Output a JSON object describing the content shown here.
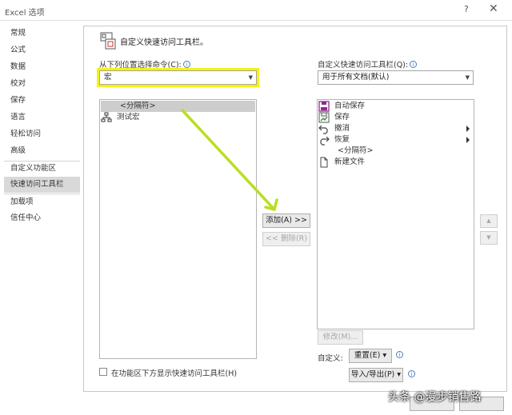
{
  "window": {
    "title": "Excel 选项",
    "help_glyph": "?",
    "close_glyph": "✕"
  },
  "sidebar": {
    "items": [
      {
        "label": "常规"
      },
      {
        "label": "公式"
      },
      {
        "label": "数据"
      },
      {
        "label": "校对"
      },
      {
        "label": "保存"
      },
      {
        "label": "语言"
      },
      {
        "label": "轻松访问"
      },
      {
        "label": "高级"
      },
      {
        "label": "自定义功能区"
      },
      {
        "label": "快速访问工具栏",
        "active": true
      },
      {
        "label": "加载项"
      },
      {
        "label": "信任中心"
      }
    ]
  },
  "header": {
    "title": "自定义快速访问工具栏。"
  },
  "left": {
    "choose_label": "从下列位置选择命令(C):",
    "choose_value": "宏",
    "items": [
      {
        "label": "<分隔符>",
        "icon": "separator",
        "selected": true
      },
      {
        "label": "测试宏",
        "icon": "macro-icon"
      }
    ],
    "checkbox_label": "在功能区下方显示快速访问工具栏(H)"
  },
  "middle": {
    "add_label": "添加(A) >>",
    "remove_label": "<< 删除(R)"
  },
  "right": {
    "customize_label": "自定义快速访问工具栏(Q):",
    "customize_value": "用于所有文档(默认)",
    "items": [
      {
        "label": "自动保存",
        "icon": "autosave-icon"
      },
      {
        "label": "保存",
        "icon": "save-icon"
      },
      {
        "label": "撤消",
        "icon": "undo-icon",
        "submenu": true
      },
      {
        "label": "恢复",
        "icon": "redo-icon",
        "submenu": true
      },
      {
        "label": "<分隔符>",
        "icon": "separator"
      },
      {
        "label": "新建文件",
        "icon": "new-file-icon"
      }
    ],
    "modify_label": "修改(M)...",
    "custom_label": "自定义:",
    "reset_label": "重置(E) ▾",
    "import_export_label": "导入/导出(P) ▾",
    "up_glyph": "▲",
    "down_glyph": "▼"
  },
  "info_glyph": "i",
  "watermark": "头条 @漫步销售路",
  "colors": {
    "highlight": "#f5f210",
    "arrow": "#b7e021",
    "selection": "#cdcdcd",
    "active_nav": "#d9d9d9"
  }
}
